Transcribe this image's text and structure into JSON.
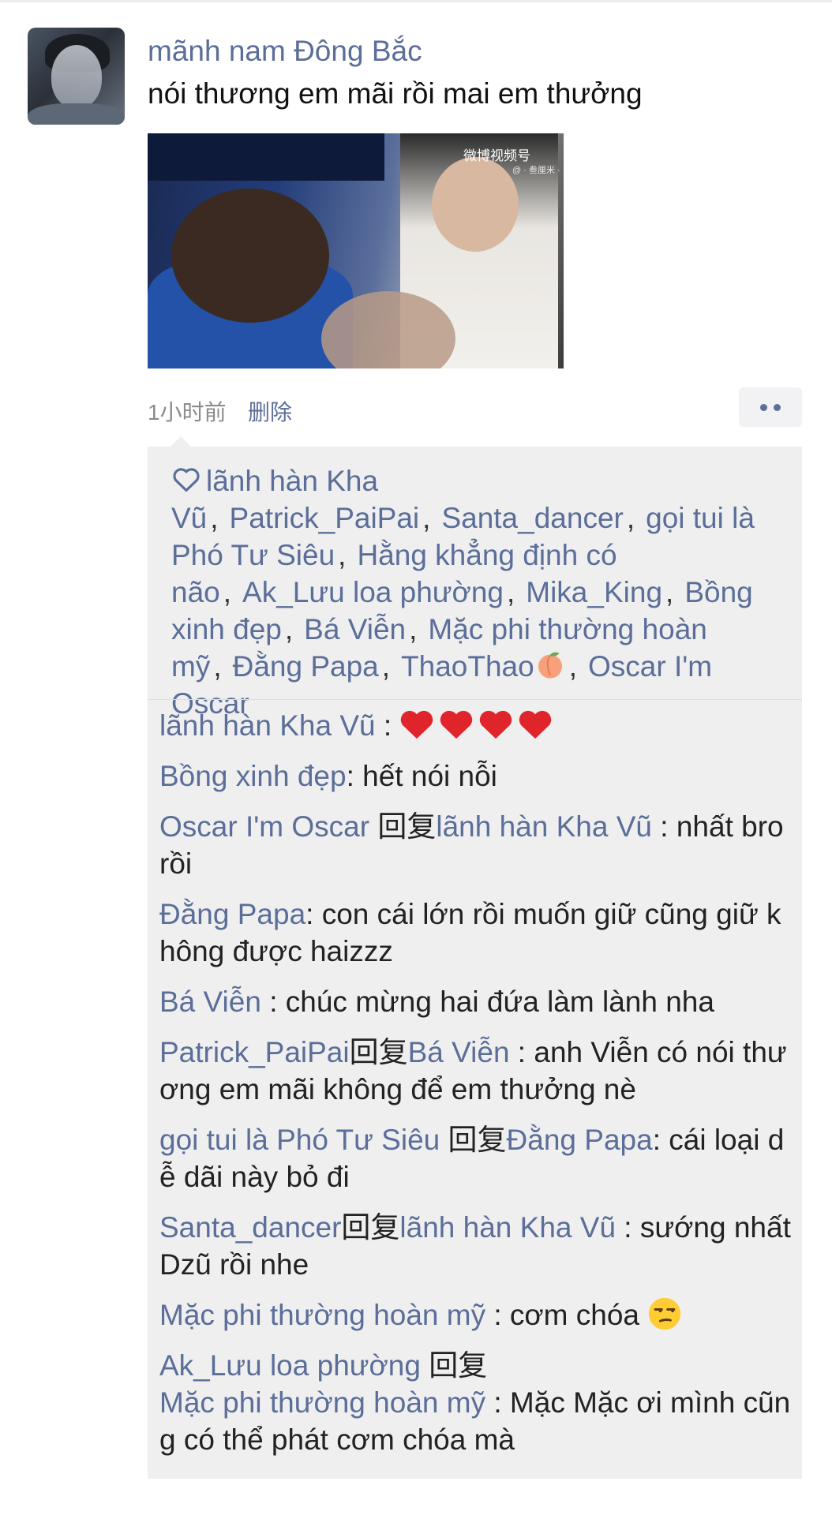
{
  "post": {
    "username": "mãnh nam Đông Bắc",
    "text": "nói thương em mãi rồi mai em thưởng",
    "image_watermark": "微博视频号",
    "image_watermark_sub": "@ · 叁厘米 ·",
    "time": "1小时前",
    "delete_label": "删除"
  },
  "likes": {
    "icon": "heart-outline-icon",
    "names": [
      "lãnh hàn Kha Vũ",
      "Patrick_PaiPai",
      "Santa_dancer",
      "gọi tui là Phó Tư Siêu",
      "Hằng khẳng định có não",
      "Ak_Lưu loa phường",
      "Mika_King",
      "Bồng xinh đẹp",
      "Bá Viễn",
      "Mặc phi thường hoàn mỹ",
      "Đằng Papa",
      "ThaoThao",
      "Oscar I'm Oscar"
    ],
    "separator": ","
  },
  "comments": {
    "reply_word": "回复",
    "items": [
      {
        "author": "lãnh hàn Kha Vũ",
        "text": " : ",
        "emoji": "red-heart-icon x4"
      },
      {
        "author": "Bồng xinh đẹp",
        "text": ": hết nói nỗi"
      },
      {
        "author": "Oscar I'm Oscar",
        "reply_to": "lãnh hàn Kha Vũ",
        "text": " : nhất bro rồi"
      },
      {
        "author": "Đằng Papa",
        "text": ": con cái lớn rồi muốn giữ cũng giữ không được haizzz"
      },
      {
        "author": "Bá Viễn",
        "text": " : chúc mừng hai đứa làm lành nha"
      },
      {
        "author": "Patrick_PaiPai",
        "reply_to": "Bá Viễn",
        "text": " : anh Viễn có nói thương em mãi không để em thưởng nè"
      },
      {
        "author": "gọi tui là Phó Tư Siêu",
        "reply_to": "Đằng Papa",
        "text": ": cái loại dễ dãi này bỏ đi"
      },
      {
        "author": "Santa_dancer",
        "reply_to": "lãnh hàn Kha Vũ",
        "text": " : sướng nhất Dzũ rồi nhe"
      },
      {
        "author": "Mặc phi thường hoàn mỹ",
        "text": " : cơm chóa ",
        "emoji": "unamused-face-icon"
      },
      {
        "author": "Ak_Lưu loa phường",
        "reply_to": "Mặc phi thường hoàn mỹ",
        "text": " : Mặc Mặc ơi mình cũng có thể phát cơm chóa mà"
      }
    ]
  },
  "colors": {
    "link": "#5b6e99",
    "text": "#111111",
    "panel": "#efefef",
    "meta": "#8a8a8a"
  }
}
